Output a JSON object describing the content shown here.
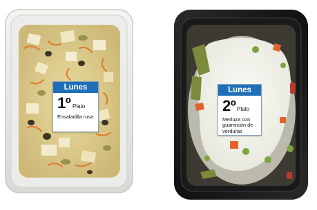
{
  "left_tray": {
    "label": {
      "day": "Lunes",
      "number": "1º",
      "course": "Plato",
      "dish": "Ensaladilla rusa"
    }
  },
  "right_tray": {
    "label": {
      "day": "Lunes",
      "number": "2º",
      "course": "Plato",
      "dish": "Merluza con guarnición de verduras"
    }
  }
}
